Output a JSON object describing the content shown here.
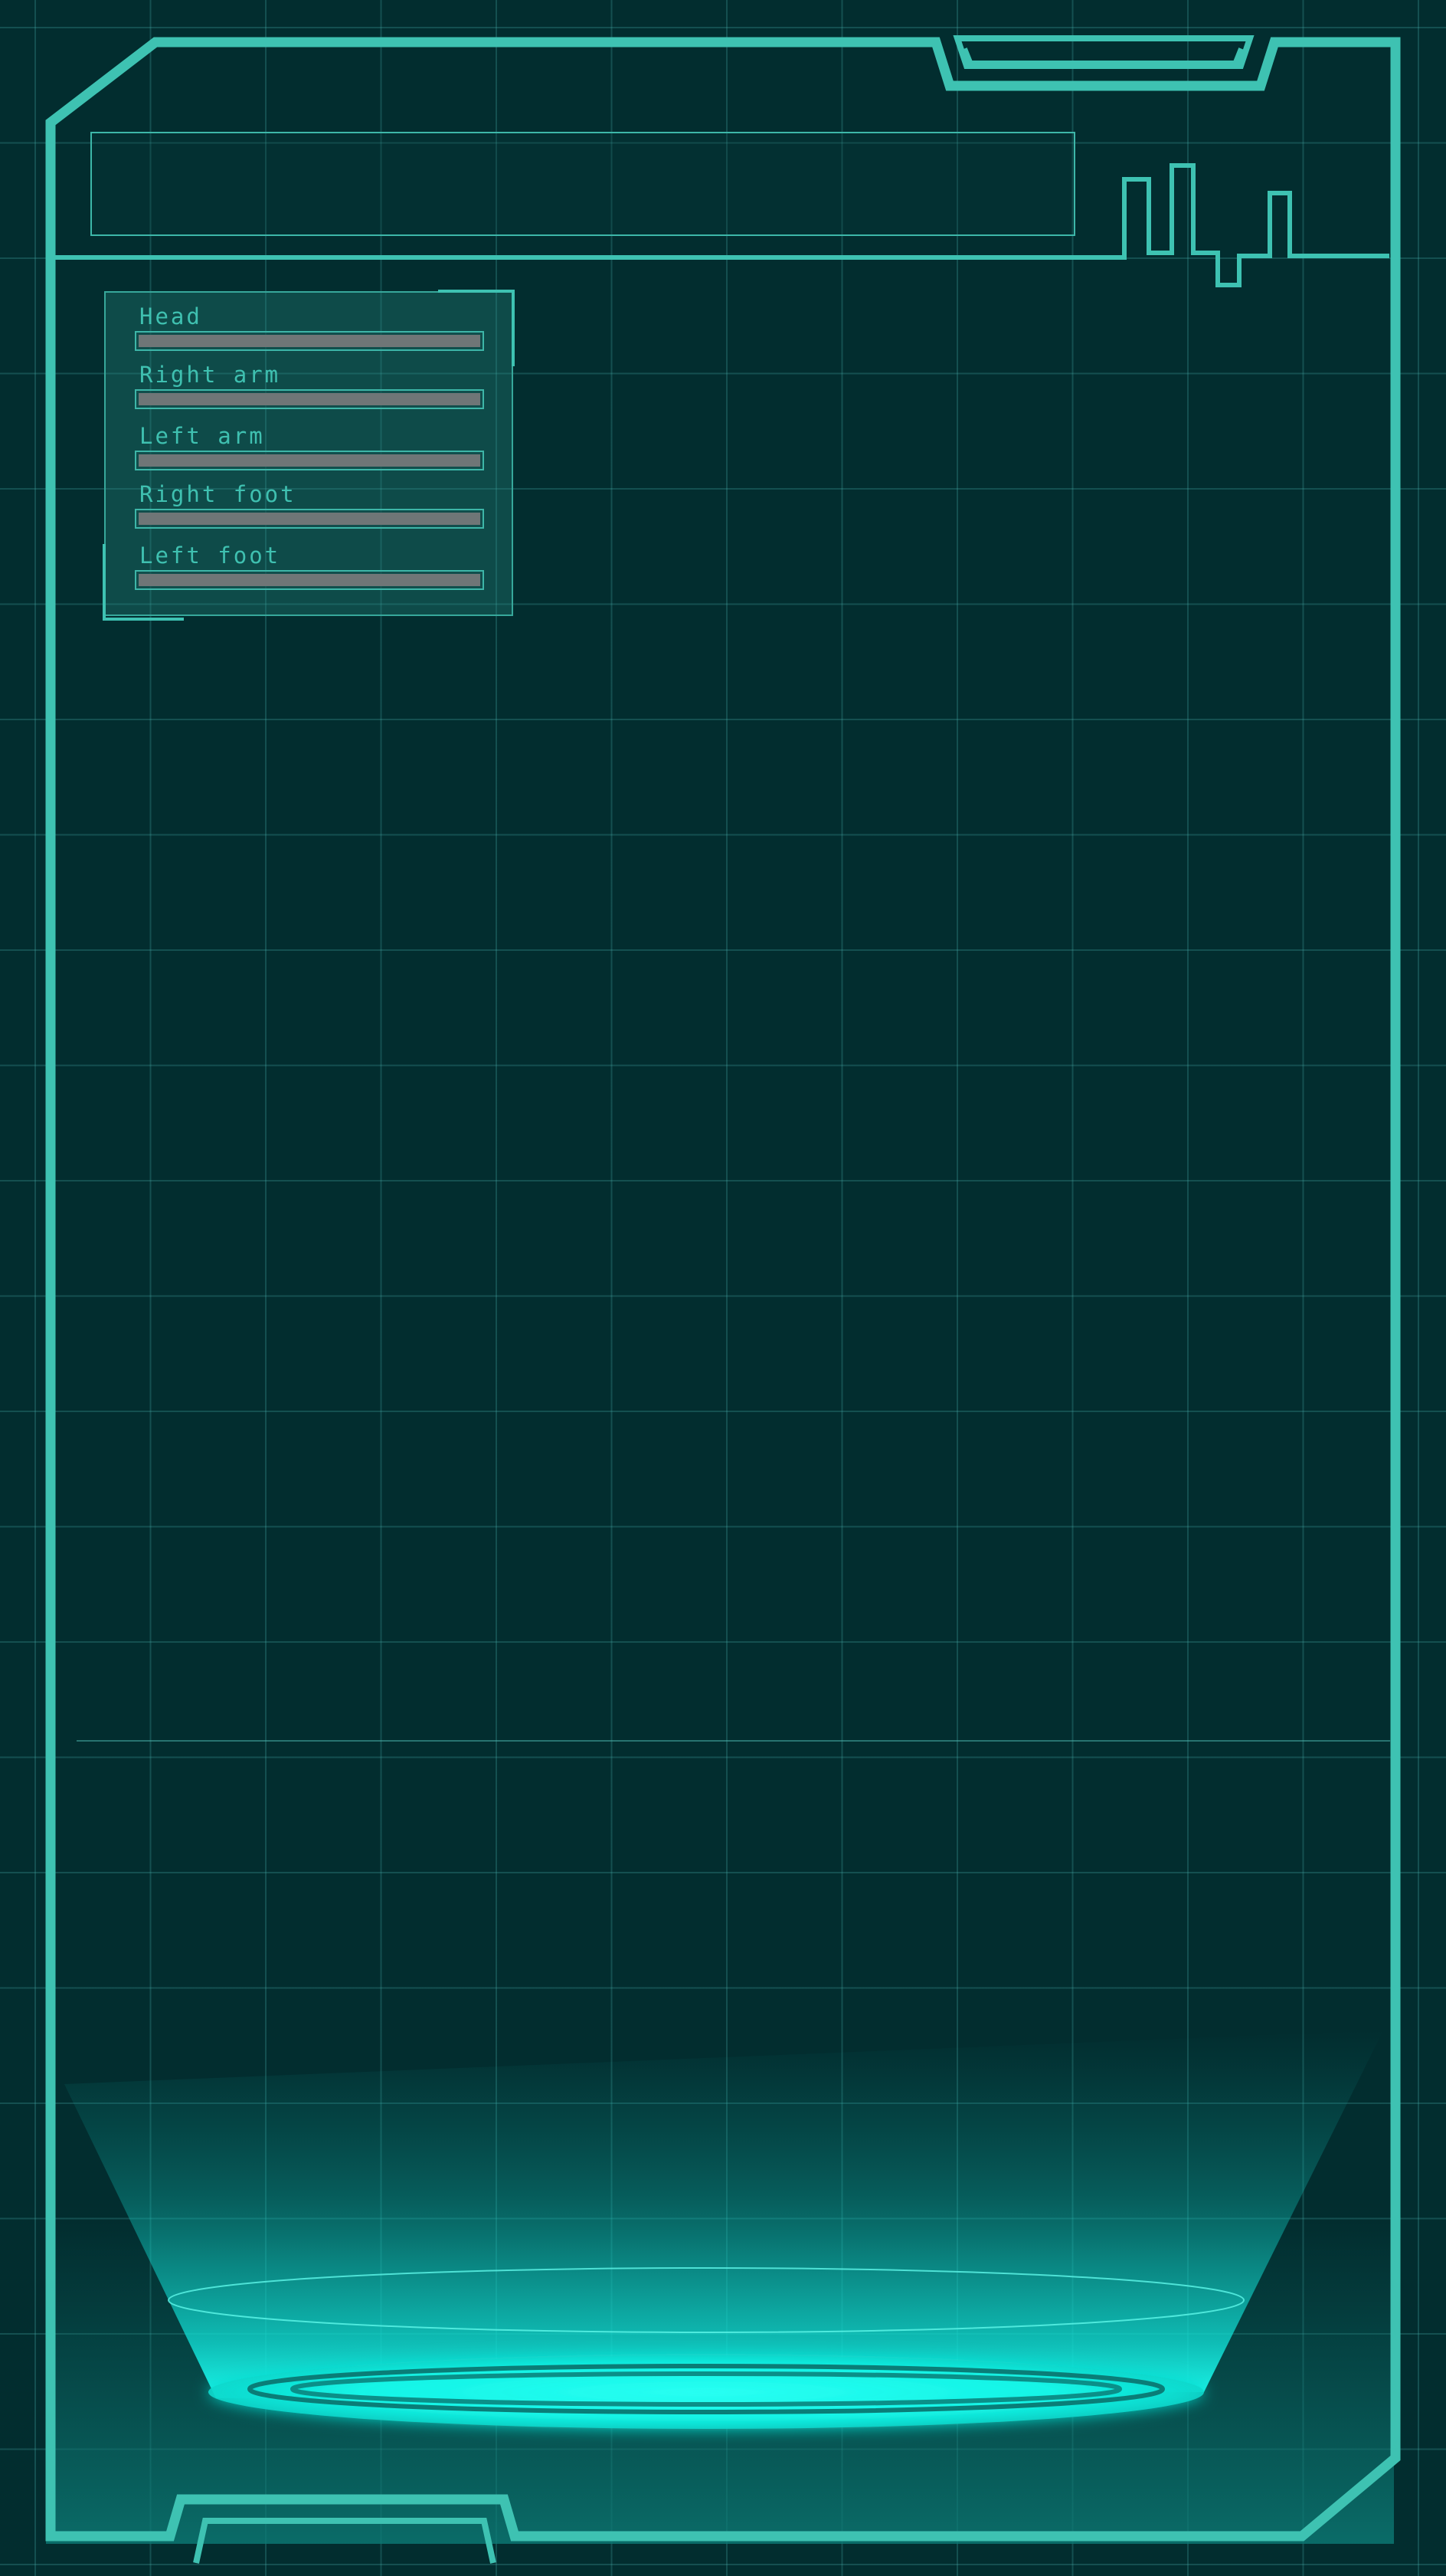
{
  "title_bar": {
    "text": ""
  },
  "status_panel": {
    "parts": [
      {
        "label": "Head",
        "health": 1.0
      },
      {
        "label": "Right arm",
        "health": 1.0
      },
      {
        "label": "Left arm",
        "health": 1.0
      },
      {
        "label": "Right foot",
        "health": 1.0
      },
      {
        "label": "Left foot",
        "health": 1.0
      }
    ]
  },
  "colors": {
    "background": "#022d2f",
    "frame": "#3ec2b2",
    "grid": "#46aaa5",
    "portal_glow": "#10fff0",
    "bar_fill": "#6f7677"
  },
  "icons": {
    "signal_pulse": "signal-pulse-icon",
    "portal": "hologram-portal-icon"
  }
}
